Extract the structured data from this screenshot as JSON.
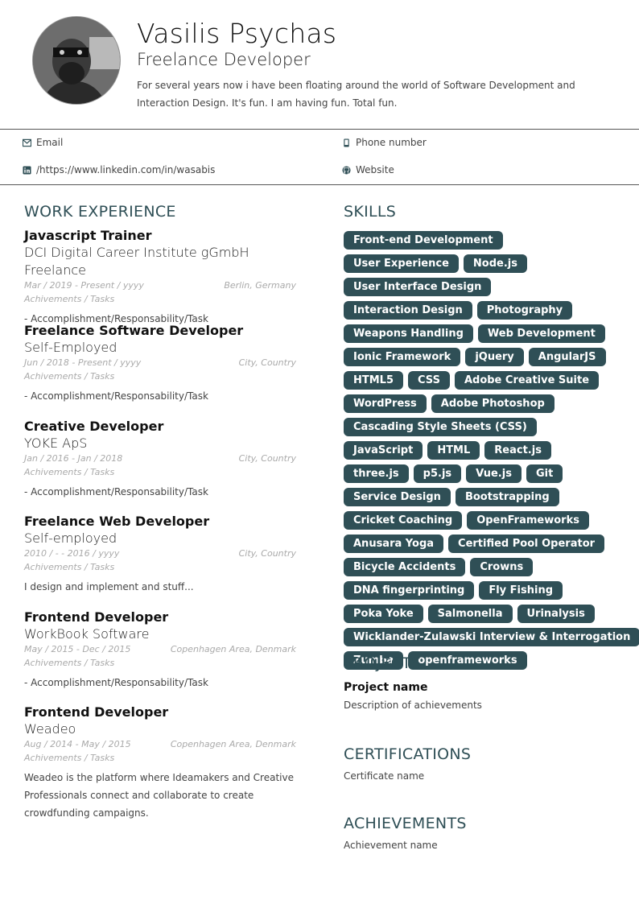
{
  "header": {
    "name": "Vasilis Psychas",
    "role": "Freelance Developer",
    "summary": "For several years now i have been floating around the world of Software Development and Interaction Design. It's fun. I am having fun. Total fun."
  },
  "contacts": {
    "email": "Email",
    "phone": "Phone number",
    "linkedin": "/https://www.linkedin.com/in/wasabis",
    "website": "Website"
  },
  "sections": {
    "work": "WORK EXPERIENCE",
    "skills": "SKILLS",
    "projects": "PROJECTS",
    "certifications": "CERTIFICATIONS",
    "achievements": "ACHIEVEMENTS"
  },
  "jobs": [
    {
      "title": "Javascript Trainer",
      "company": "DCI Digital Career Institute gGmbH Freelance",
      "dates": "Mar  /  2019  -  Present  /  yyyy",
      "location": "Berlin, Germany",
      "achievements_label": "Achivements / Tasks",
      "description": "- Accomplishment/Responsability/Task"
    },
    {
      "title": "Freelance Software Developer",
      "company": "Self-Employed",
      "dates": "Jun  /  2018  -  Present  /  yyyy",
      "location": "City, Country",
      "achievements_label": "Achivements / Tasks",
      "description": "- Accomplishment/Responsability/Task"
    },
    {
      "title": "Creative Developer",
      "company": "YOKE ApS",
      "dates": "Jan  /  2016  -  Jan  /  2018",
      "location": "City, Country",
      "achievements_label": "Achivements / Tasks",
      "description": "- Accomplishment/Responsability/Task"
    },
    {
      "title": "Freelance Web Developer",
      "company": "Self-employed",
      "dates": "2010  /  -  -  2016  /  yyyy",
      "location": "City, Country",
      "achievements_label": "Achivements / Tasks",
      "description": "I design and implement and stuff..."
    },
    {
      "title": "Frontend Developer",
      "company": "WorkBook Software",
      "dates": "May  /  2015  -  Dec  /  2015",
      "location": "Copenhagen Area, Denmark",
      "achievements_label": "Achivements / Tasks",
      "description": "- Accomplishment/Responsability/Task"
    },
    {
      "title": "Frontend Developer",
      "company": "Weadeo",
      "dates": "Aug  /  2014  -  May  /  2015",
      "location": "Copenhagen Area, Denmark",
      "achievements_label": "Achivements / Tasks",
      "description": "Weadeo is the platform where Ideamakers and Creative Professionals connect and collaborate to create crowdfunding campaigns."
    }
  ],
  "skills": [
    "Front-end Development",
    "User Experience",
    "Node.js",
    "User Interface Design",
    "Interaction Design",
    "Photography",
    "Weapons Handling",
    "Web Development",
    "Ionic Framework",
    "jQuery",
    "AngularJS",
    "HTML5",
    "CSS",
    "Adobe Creative Suite",
    "WordPress",
    "Adobe Photoshop",
    "Cascading Style Sheets (CSS)",
    "JavaScript",
    "HTML",
    "React.js",
    "three.js",
    "p5.js",
    "Vue.js",
    "Git",
    "Service Design",
    "Bootstrapping",
    "Cricket Coaching",
    "OpenFrameworks",
    "Anusara Yoga",
    "Certified Pool Operator",
    "Bicycle Accidents",
    "Crowns",
    "DNA fingerprinting",
    "Fly Fishing",
    "Poka Yoke",
    "Salmonella",
    "Urinalysis",
    "Wicklander-Zulawski Interview & Interrogation",
    "Zumba",
    "openframeworks"
  ],
  "projects": {
    "name": "Project name",
    "description": "Description of achievements"
  },
  "certifications": {
    "name": "Certificate name"
  },
  "achievements": {
    "name": "Achievement name"
  },
  "colors": {
    "accent": "#2f4f56"
  }
}
